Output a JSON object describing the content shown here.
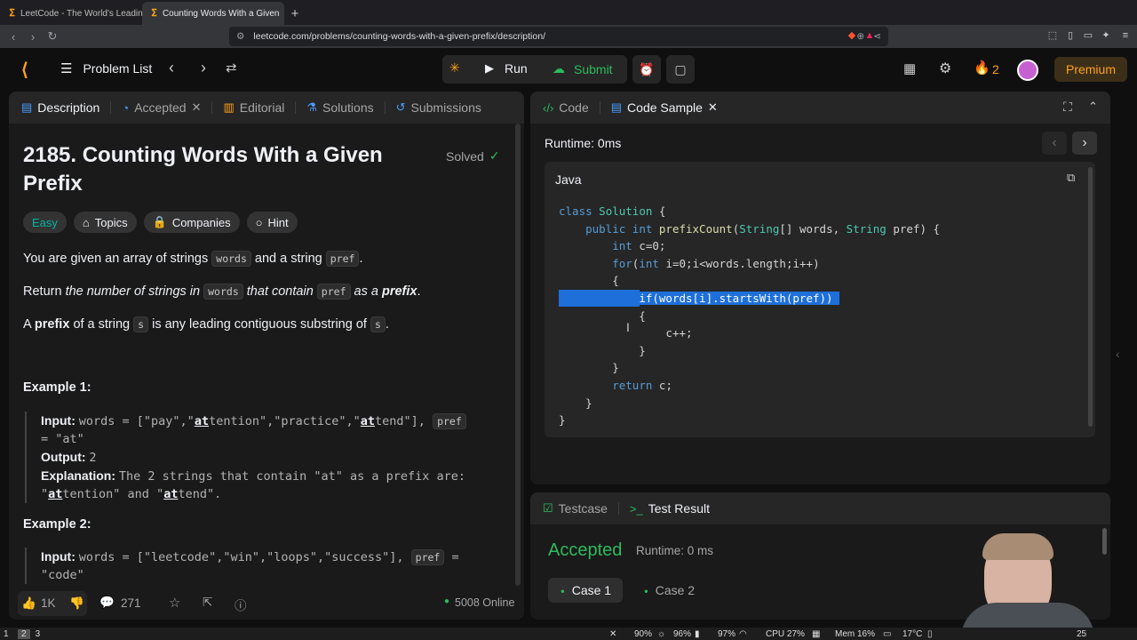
{
  "browser": {
    "tabs": [
      {
        "title": "LeetCode - The World's Leading",
        "active": false
      },
      {
        "title": "Counting Words With a Given",
        "active": true
      }
    ],
    "url": "leetcode.com/problems/counting-words-with-a-given-prefix/description/"
  },
  "header": {
    "problem_list": "Problem List",
    "run": "Run",
    "submit": "Submit",
    "streak": "2",
    "premium": "Premium",
    "accent": "#ffa116"
  },
  "left_panel": {
    "tabs": [
      "Description",
      "Accepted",
      "Editorial",
      "Solutions",
      "Submissions"
    ],
    "title_line1": "2185. Counting Words With a Given",
    "title_line2": "Prefix",
    "solved": "Solved",
    "difficulty": "Easy",
    "chips": [
      "Topics",
      "Companies",
      "Hint"
    ],
    "p1_a": "You are given an array of strings",
    "p1_code1": "words",
    "p1_b": "and a string",
    "p1_code2": "pref",
    "p1_c": ".",
    "p2_a": "Return",
    "p2_b": "the number of strings in",
    "p2_code1": "words",
    "p2_c": "that contain",
    "p2_code2": "pref",
    "p2_d": "as a",
    "p2_e": "prefix",
    "p2_f": ".",
    "p3_a": "A",
    "p3_b": "prefix",
    "p3_c": "of a string",
    "p3_code": "s",
    "p3_d": "is any leading contiguous substring of",
    "p3_code2": "s",
    "p3_e": ".",
    "ex1_title": "Example 1:",
    "ex1_input_label": "Input:",
    "ex1_input_a": "words = [\"pay\",\"",
    "ex1_input_b": "at",
    "ex1_input_c": "tention\",\"practice\",\"",
    "ex1_input_d": "at",
    "ex1_input_e": "tend\"],",
    "ex1_pref": "pref",
    "ex1_input_f": "= \"at\"",
    "ex1_output_label": "Output:",
    "ex1_output": "2",
    "ex1_expl_label": "Explanation:",
    "ex1_expl_a": "The 2 strings that contain \"at\" as a prefix are:",
    "ex1_expl_b": "\"",
    "ex1_expl_c": "at",
    "ex1_expl_d": "tention\" and \"",
    "ex1_expl_e": "at",
    "ex1_expl_f": "tend\".",
    "ex2_title": "Example 2:",
    "ex2_input_label": "Input:",
    "ex2_input_a": "words = [\"leetcode\",\"win\",\"loops\",\"success\"],",
    "ex2_pref": "pref",
    "ex2_input_b": "=",
    "ex2_input_c": "\"code\"",
    "footer": {
      "likes": "1K",
      "comments": "271",
      "online": "5008 Online"
    }
  },
  "code_panel": {
    "tabs": [
      "Code",
      "Code Sample"
    ],
    "runtime": "Runtime: 0ms",
    "language": "Java",
    "lines": [
      "class Solution {",
      "    public int prefixCount(String[] words, String pref) {",
      "        int c=0;",
      "        for(int i=0;i<words.length;i++)",
      "        {",
      "            if(words[i].startsWith(pref))",
      "            {",
      "                c++;",
      "            }",
      "        }",
      "        return c;",
      "    }",
      "}"
    ],
    "highlighted_line": 5
  },
  "result_panel": {
    "tabs": [
      "Testcase",
      "Test Result"
    ],
    "status": "Accepted",
    "runtime": "Runtime: 0 ms",
    "cases": [
      "Case 1",
      "Case 2"
    ],
    "accepted_color": "#2cbb5d"
  },
  "taskbar": {
    "workspaces": [
      "1",
      "2",
      "3"
    ],
    "volume": "90%",
    "mic": "96%",
    "wifi": "97%",
    "cpu": "CPU 27%",
    "mem": "Mem 16%",
    "temp": "17°C",
    "time": "25"
  }
}
